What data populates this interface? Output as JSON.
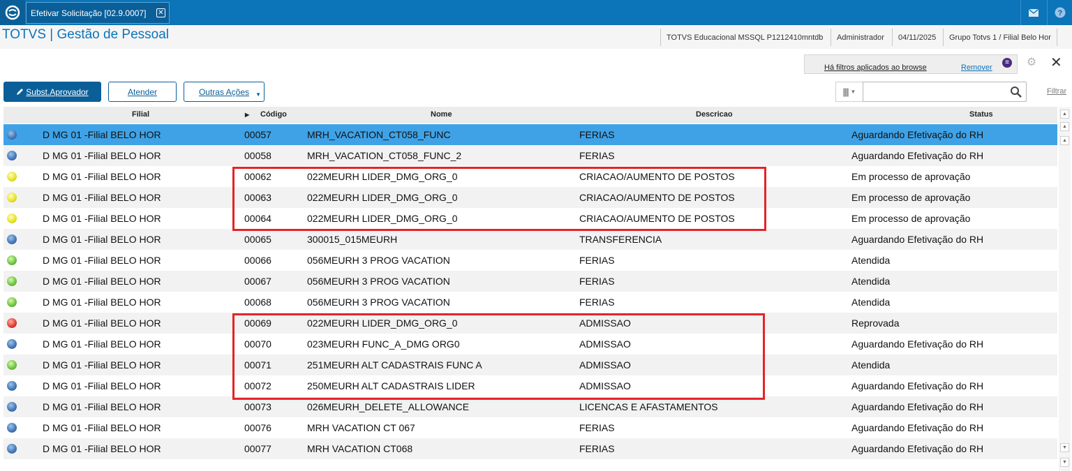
{
  "topbar": {
    "tab_title": "Efetivar Solicitação [02.9.0007]",
    "tab_close": "✕"
  },
  "header": {
    "app_title": "TOTVS | Gestão de Pessoal",
    "environment": "TOTVS Educacional MSSQL P1212410mntdb",
    "user": "Administrador",
    "date": "04/11/2025",
    "branch": "Grupo Totvs 1 / Filial Belo Hor"
  },
  "filters": {
    "notice": "Há filtros aplicados ao browse",
    "remove": "Remover"
  },
  "toolbar": {
    "subst_label": "Subst.Aprovador",
    "atender_label": "Atender",
    "outras_label": "Outras Ações",
    "search_placeholder": "",
    "filtrar_label": "Filtrar"
  },
  "grid": {
    "columns": {
      "filial": "Filial",
      "codigo": "Código",
      "nome": "Nome",
      "descricao": "Descricao",
      "status": "Status"
    },
    "rows": [
      {
        "legend": "blue",
        "filial": "D MG 01 -Filial BELO HOR",
        "codigo": "00057",
        "nome": "MRH_VACATION_CT058_FUNC",
        "descricao": "FERIAS",
        "status": "Aguardando Efetivação do RH"
      },
      {
        "legend": "blue",
        "filial": "D MG 01 -Filial BELO HOR",
        "codigo": "00058",
        "nome": "MRH_VACATION_CT058_FUNC_2",
        "descricao": "FERIAS",
        "status": "Aguardando Efetivação do RH"
      },
      {
        "legend": "yellow",
        "filial": "D MG 01 -Filial BELO HOR",
        "codigo": "00062",
        "nome": "022MEURH LIDER_DMG_ORG_0",
        "descricao": "CRIACAO/AUMENTO DE POSTOS",
        "status": "Em processo de aprovação"
      },
      {
        "legend": "yellow",
        "filial": "D MG 01 -Filial BELO HOR",
        "codigo": "00063",
        "nome": "022MEURH LIDER_DMG_ORG_0",
        "descricao": "CRIACAO/AUMENTO DE POSTOS",
        "status": "Em processo de aprovação"
      },
      {
        "legend": "yellow",
        "filial": "D MG 01 -Filial BELO HOR",
        "codigo": "00064",
        "nome": "022MEURH LIDER_DMG_ORG_0",
        "descricao": "CRIACAO/AUMENTO DE POSTOS",
        "status": "Em processo de aprovação"
      },
      {
        "legend": "blue",
        "filial": "D MG 01 -Filial BELO HOR",
        "codigo": "00065",
        "nome": "300015_015MEURH",
        "descricao": "TRANSFERENCIA",
        "status": "Aguardando Efetivação do RH"
      },
      {
        "legend": "green",
        "filial": "D MG 01 -Filial BELO HOR",
        "codigo": "00066",
        "nome": "056MEURH 3 PROG VACATION",
        "descricao": "FERIAS",
        "status": "Atendida"
      },
      {
        "legend": "green",
        "filial": "D MG 01 -Filial BELO HOR",
        "codigo": "00067",
        "nome": "056MEURH 3 PROG VACATION",
        "descricao": "FERIAS",
        "status": "Atendida"
      },
      {
        "legend": "green",
        "filial": "D MG 01 -Filial BELO HOR",
        "codigo": "00068",
        "nome": "056MEURH 3 PROG VACATION",
        "descricao": "FERIAS",
        "status": "Atendida"
      },
      {
        "legend": "red",
        "filial": "D MG 01 -Filial BELO HOR",
        "codigo": "00069",
        "nome": "022MEURH LIDER_DMG_ORG_0",
        "descricao": "ADMISSAO",
        "status": "Reprovada"
      },
      {
        "legend": "blue",
        "filial": "D MG 01 -Filial BELO HOR",
        "codigo": "00070",
        "nome": "023MEURH FUNC_A_DMG ORG0",
        "descricao": "ADMISSAO",
        "status": "Aguardando Efetivação do RH"
      },
      {
        "legend": "green",
        "filial": "D MG 01 -Filial BELO HOR",
        "codigo": "00071",
        "nome": "251MEURH ALT CADASTRAIS FUNC A",
        "descricao": "ADMISSAO",
        "status": "Atendida"
      },
      {
        "legend": "blue",
        "filial": "D MG 01 -Filial BELO HOR",
        "codigo": "00072",
        "nome": "250MEURH ALT CADASTRAIS LIDER",
        "descricao": "ADMISSAO",
        "status": "Aguardando Efetivação do RH"
      },
      {
        "legend": "blue",
        "filial": "D MG 01 -Filial BELO HOR",
        "codigo": "00073",
        "nome": "026MEURH_DELETE_ALLOWANCE",
        "descricao": "LICENCAS E AFASTAMENTOS",
        "status": "Aguardando Efetivação do RH"
      },
      {
        "legend": "blue",
        "filial": "D MG 01 -Filial BELO HOR",
        "codigo": "00076",
        "nome": "MRH VACATION CT 067",
        "descricao": "FERIAS",
        "status": "Aguardando Efetivação do RH"
      },
      {
        "legend": "blue",
        "filial": "D MG 01 -Filial BELO HOR",
        "codigo": "00077",
        "nome": "MRH VACATION CT068",
        "descricao": "FERIAS",
        "status": "Aguardando Efetivação do RH"
      }
    ]
  },
  "icons": [
    "totvs-logo-icon",
    "close-icon",
    "mail-icon",
    "help-icon",
    "equalizer-icon",
    "gear-icon",
    "pencil-icon",
    "columns-icon",
    "search-icon",
    "sort-arrow-icon"
  ],
  "colors": {
    "brand": "#0c74b8",
    "selected_row": "#3fa2e6",
    "highlight": "#e32429"
  }
}
